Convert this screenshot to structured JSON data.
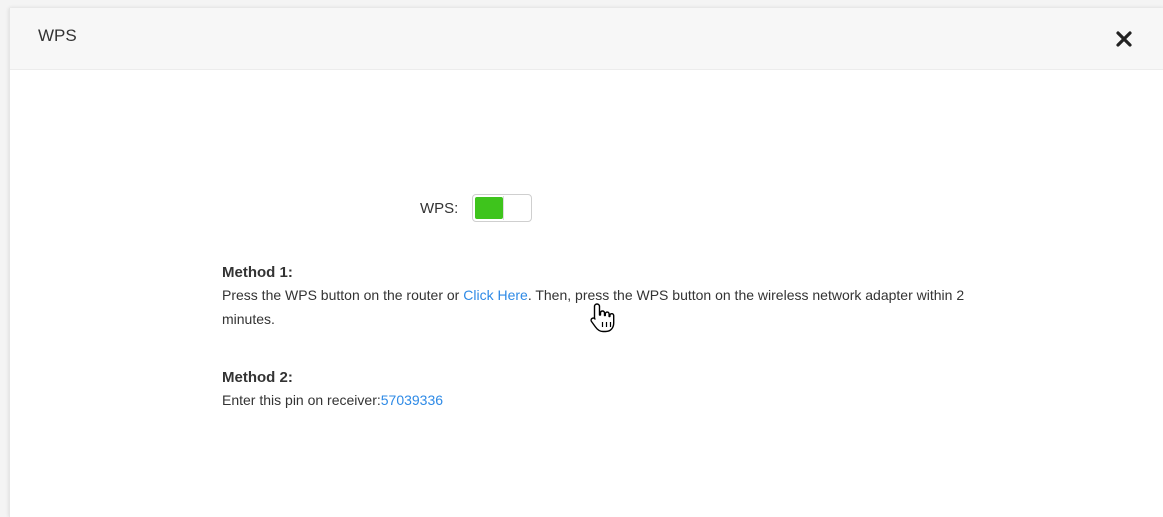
{
  "dialog": {
    "title": "WPS",
    "close_icon": "close-icon"
  },
  "wps": {
    "label": "WPS:",
    "enabled": true,
    "on_color": "#3ec41c"
  },
  "method1": {
    "title": "Method 1:",
    "text_before": "Press the WPS button on the router or ",
    "link_label": "Click Here",
    "text_after": ". Then, press the WPS button on the wireless network adapter within 2 minutes."
  },
  "method2": {
    "title": "Method 2:",
    "text": "Enter this pin on receiver:",
    "pin": "57039336"
  },
  "colors": {
    "link": "#2e8ae6"
  },
  "cursor_icon": "hand-pointer-icon"
}
